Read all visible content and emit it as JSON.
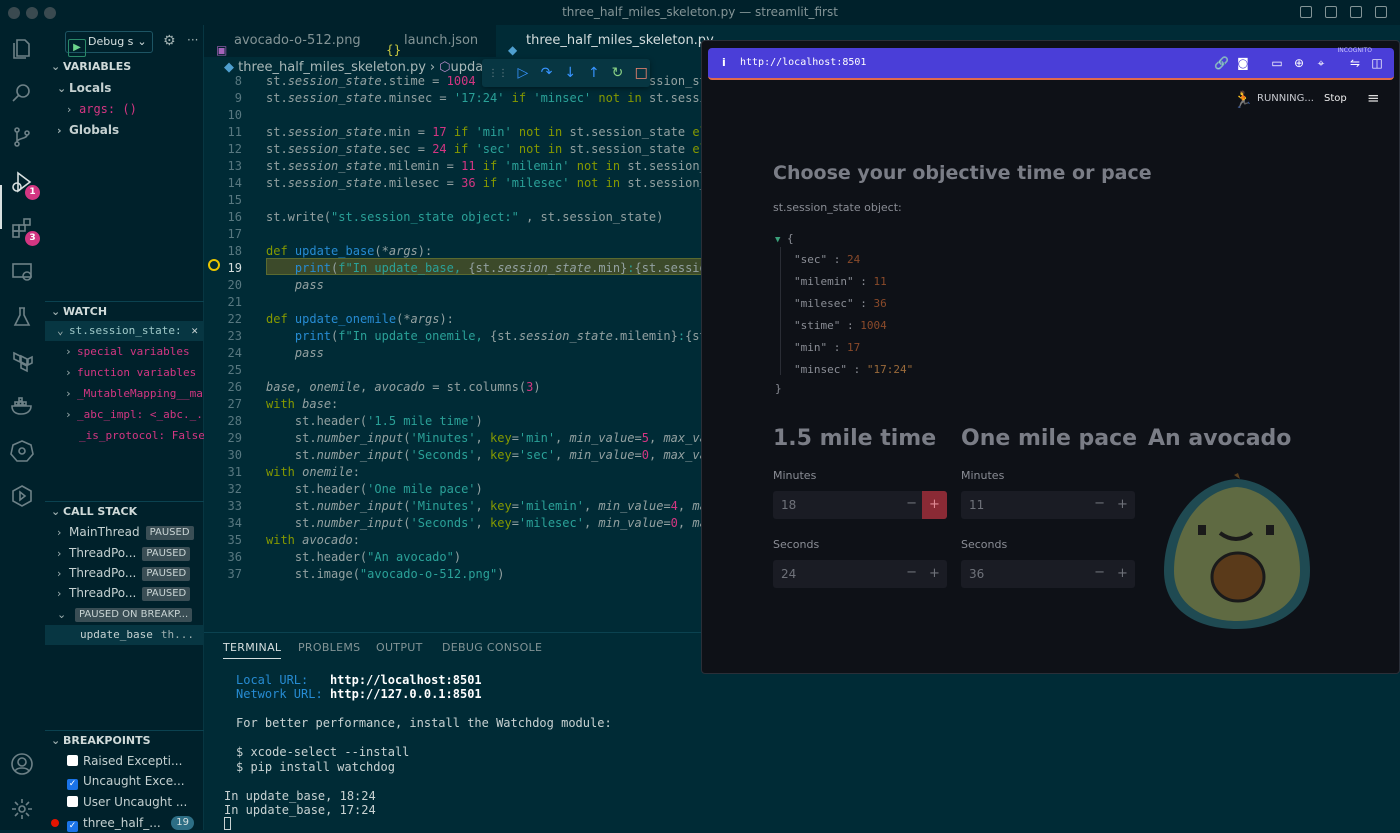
{
  "window": {
    "title": "three_half_miles_skeleton.py — streamlit_first"
  },
  "debug_toolbar": {
    "config_label": "Debug s"
  },
  "sidebar": {
    "variables_header": "VARIABLES",
    "locals_label": "Locals",
    "args_label": "args: ()",
    "globals_label": "Globals",
    "watch_header": "WATCH",
    "watch_expr": "st.session_state:",
    "watch_items": [
      "special variables",
      "function variables",
      "_MutableMapping__mar",
      "_abc_impl: <_abc._...",
      "_is_protocol: False"
    ],
    "callstack_header": "CALL STACK",
    "threads": [
      {
        "name": "MainThread",
        "status": "PAUSED"
      },
      {
        "name": "ThreadPo...",
        "status": "PAUSED"
      },
      {
        "name": "ThreadPo...",
        "status": "PAUSED"
      },
      {
        "name": "ThreadPo...",
        "status": "PAUSED"
      }
    ],
    "paused_on": "PAUSED ON BREAKP...",
    "frame": "update_base",
    "frame_file": "th...",
    "breakpoints_header": "BREAKPOINTS",
    "breakpoints": [
      {
        "label": "Raised Excepti...",
        "checked": false
      },
      {
        "label": "Uncaught Exce...",
        "checked": true
      },
      {
        "label": "User Uncaught ...",
        "checked": false
      },
      {
        "label": "three_half_...",
        "checked": true,
        "count": "19"
      }
    ]
  },
  "activity": {
    "debug_badge": "1",
    "ext_badge": "3"
  },
  "tabs": [
    {
      "label": "avocado-o-512.png",
      "icon": "image-icon"
    },
    {
      "label": "launch.json",
      "icon": "json-icon"
    },
    {
      "label": "three_half_miles_skeleton.py",
      "icon": "python-icon"
    }
  ],
  "breadcrumb": {
    "file": "three_half_miles_skeleton.py",
    "symbol": "update_"
  },
  "code": {
    "line_numbers": [
      "8",
      "9",
      "10",
      "11",
      "12",
      "13",
      "14",
      "15",
      "16",
      "17",
      "18",
      "19",
      "20",
      "21",
      "22",
      "23",
      "24",
      "25",
      "26",
      "27",
      "28",
      "29",
      "30",
      "31",
      "32",
      "33",
      "34",
      "35",
      "36",
      "37"
    ],
    "current_line": "19"
  },
  "panel": {
    "tabs": [
      "TERMINAL",
      "PROBLEMS",
      "OUTPUT",
      "DEBUG CONSOLE"
    ],
    "local_url_label": "Local URL:",
    "local_url": "http://localhost:8501",
    "network_url_label": "Network URL:",
    "network_url": "http://127.0.0.1:8501",
    "perf_msg": "For better performance, install the Watchdog module:",
    "cmd1": "$ xcode-select --install",
    "cmd2": "$ pip install watchdog",
    "out1": "In update_base, 18:24",
    "out2": "In update_base, 17:24"
  },
  "browser": {
    "url": "http://localhost:8501",
    "incognito": "INCOGNITO",
    "status": "RUNNING...",
    "stop": "Stop",
    "heading": "Choose your objective time or pace",
    "state_label": "st.session_state object:",
    "json": [
      {
        "key": "\"sec\"",
        "value": "24"
      },
      {
        "key": "\"milemin\"",
        "value": "11"
      },
      {
        "key": "\"milesec\"",
        "value": "36"
      },
      {
        "key": "\"stime\"",
        "value": "1004"
      },
      {
        "key": "\"min\"",
        "value": "17"
      },
      {
        "key": "\"minsec\"",
        "value": "\"17:24\""
      }
    ],
    "col1": {
      "header": "1.5 mile time",
      "label_min": "Minutes",
      "min_value": "18",
      "label_sec": "Seconds",
      "sec_value": "24"
    },
    "col2": {
      "header": "One mile pace",
      "label_min": "Minutes",
      "min_value": "11",
      "label_sec": "Seconds",
      "sec_value": "36"
    },
    "col3": {
      "header": "An avocado"
    }
  }
}
